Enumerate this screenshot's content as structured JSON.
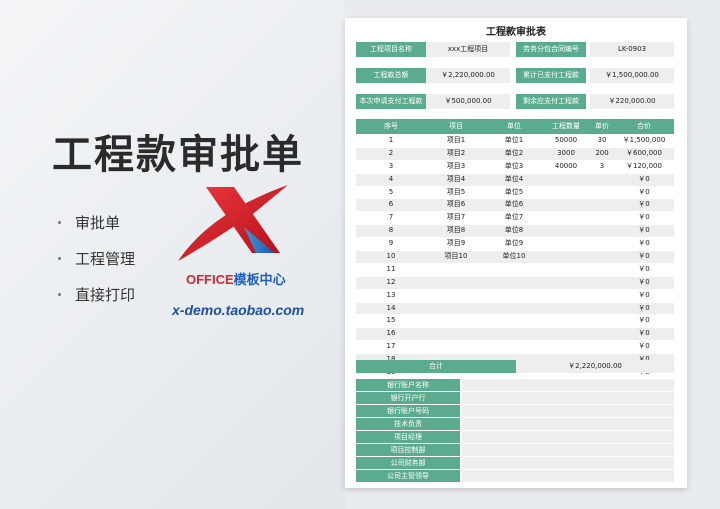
{
  "promo": {
    "title": "工程款审批单",
    "items": [
      "审批单",
      "工程管理",
      "直接打印"
    ],
    "logo_text_a": "OFFICE",
    "logo_text_b": "模板中心",
    "url": "x-demo.taobao.com"
  },
  "colors": {
    "accent": "#5bab8f",
    "cell_bg": "#eeeeee"
  },
  "sheet": {
    "title": "工程款审批表",
    "info": [
      {
        "label1": "工程项目名称",
        "value1": "xxx工程项目",
        "label2": "劳务分包合同编号",
        "value2": "LK-0903"
      },
      {
        "label1": "工程款总额",
        "value1": "￥2,220,000.00",
        "label2": "累计已支付工程款",
        "value2": "￥1,500,000.00"
      },
      {
        "label1": "本次申请支付工程款",
        "value1": "￥500,000.00",
        "label2": "剩余应支付工程款",
        "value2": "￥220,000.00"
      }
    ],
    "table": {
      "headers": {
        "seq": "序号",
        "item": "项目",
        "unit": "单位",
        "qty": "工程数量",
        "price": "单价",
        "total": "合价"
      },
      "rows": [
        {
          "seq": "1",
          "item": "项目1",
          "unit": "单位1",
          "qty": "50000",
          "price": "30",
          "total": "￥1,500,000"
        },
        {
          "seq": "2",
          "item": "项目2",
          "unit": "单位2",
          "qty": "3000",
          "price": "200",
          "total": "￥600,000"
        },
        {
          "seq": "3",
          "item": "项目3",
          "unit": "单位3",
          "qty": "40000",
          "price": "3",
          "total": "￥120,000"
        },
        {
          "seq": "4",
          "item": "项目4",
          "unit": "单位4",
          "qty": "",
          "price": "",
          "total": "￥0"
        },
        {
          "seq": "5",
          "item": "项目5",
          "unit": "单位5",
          "qty": "",
          "price": "",
          "total": "￥0"
        },
        {
          "seq": "6",
          "item": "项目6",
          "unit": "单位6",
          "qty": "",
          "price": "",
          "total": "￥0"
        },
        {
          "seq": "7",
          "item": "项目7",
          "unit": "单位7",
          "qty": "",
          "price": "",
          "total": "￥0"
        },
        {
          "seq": "8",
          "item": "项目8",
          "unit": "单位8",
          "qty": "",
          "price": "",
          "total": "￥0"
        },
        {
          "seq": "9",
          "item": "项目9",
          "unit": "单位9",
          "qty": "",
          "price": "",
          "total": "￥0"
        },
        {
          "seq": "10",
          "item": "项目10",
          "unit": "单位10",
          "qty": "",
          "price": "",
          "total": "￥0"
        },
        {
          "seq": "11",
          "item": "",
          "unit": "",
          "qty": "",
          "price": "",
          "total": "￥0"
        },
        {
          "seq": "12",
          "item": "",
          "unit": "",
          "qty": "",
          "price": "",
          "total": "￥0"
        },
        {
          "seq": "13",
          "item": "",
          "unit": "",
          "qty": "",
          "price": "",
          "total": "￥0"
        },
        {
          "seq": "14",
          "item": "",
          "unit": "",
          "qty": "",
          "price": "",
          "total": "￥0"
        },
        {
          "seq": "15",
          "item": "",
          "unit": "",
          "qty": "",
          "price": "",
          "total": "￥0"
        },
        {
          "seq": "16",
          "item": "",
          "unit": "",
          "qty": "",
          "price": "",
          "total": "￥0"
        },
        {
          "seq": "17",
          "item": "",
          "unit": "",
          "qty": "",
          "price": "",
          "total": "￥0"
        },
        {
          "seq": "18",
          "item": "",
          "unit": "",
          "qty": "",
          "price": "",
          "total": "￥0"
        },
        {
          "seq": "19",
          "item": "",
          "unit": "",
          "qty": "",
          "price": "",
          "total": "￥0"
        }
      ],
      "total_label": "合计",
      "total_value": "￥2,220,000.00"
    },
    "sign_rows": [
      "银行账户名称",
      "银行开户行",
      "银行账户号码",
      "技术负责",
      "项目经理",
      "项目控制部",
      "公司财务部",
      "公司主管领导"
    ]
  }
}
